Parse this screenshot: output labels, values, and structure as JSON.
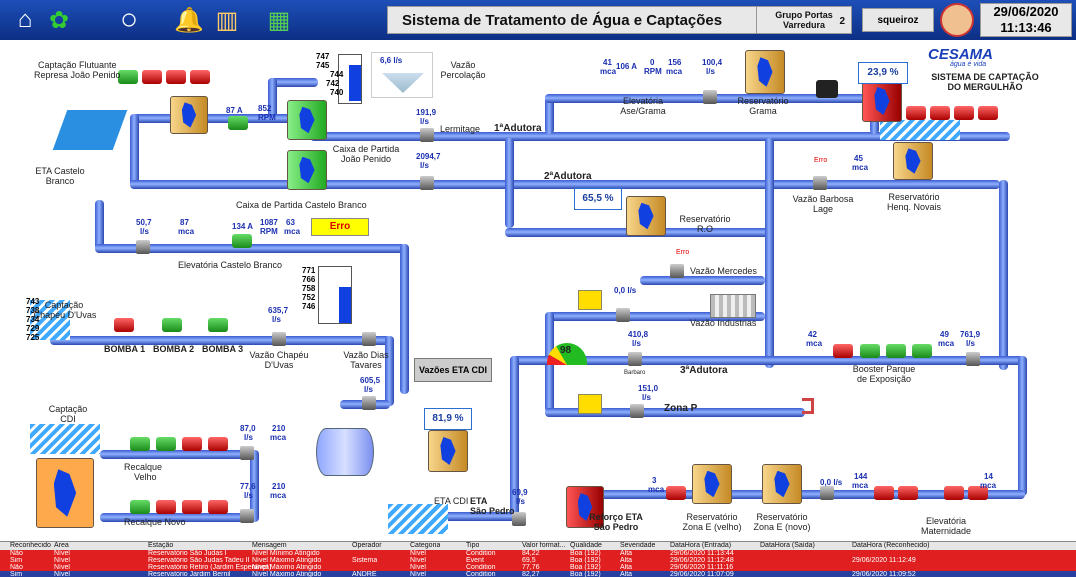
{
  "header": {
    "title": "Sistema de Tratamento de Água e Captações",
    "group_l1": "Grupo Portas",
    "group_l2": "Varredura",
    "group_num": "2",
    "user": "squeiroz",
    "date": "29/06/2020",
    "time": "11:13:46"
  },
  "toolbar": {
    "icons": [
      "home-icon",
      "puzzle-icon",
      "search-icon",
      "alarm-bell-icon",
      "panel-icon",
      "grid-icon"
    ]
  },
  "logo": {
    "brand": "CESAMA",
    "tagline": "água é vida",
    "system_l1": "SISTEMA DE CAPTAÇÃO",
    "system_l2": "DO MERGULHÃO"
  },
  "labels": {
    "captacao_flutuante": "Captação Flutuante",
    "represa": "Represa João Penido",
    "eta_cb_1": "ETA Castelo",
    "eta_cb_2": "Branco",
    "vazao_perc_1": "Vazão",
    "vazao_perc_2": "Percolação",
    "perc_val": "6,6 l/s",
    "caixa_jp_1": "Caixa de Partida",
    "caixa_jp_2": "João Penido",
    "lermitage": "Lermitage",
    "adutora1": "1ªAdutora",
    "adutora2": "2ªAdutora",
    "adutora3": "3ªAdutora",
    "caixa_cb": "Caixa de Partida Castelo Branco",
    "elev_cb": "Elevatória Castelo Branco",
    "elev_ase_1": "Elevatória",
    "elev_ase_2": "Ase/Grama",
    "res_grama_1": "Reservatório",
    "res_grama_2": "Grama",
    "vazao_bl_1": "Vazão Barbosa",
    "vazao_bl_2": "Lage",
    "res_hn_1": "Reservatório",
    "res_hn_2": "Henq. Novais",
    "res_ro_1": "Reservatório",
    "res_ro_2": "R.O",
    "vazao_merc": "Vazão Mercedes",
    "vazao_ind": "Vazão Industrias",
    "captacao_cu_1": "Captação",
    "captacao_cu_2": "Chapéu D'Uvas",
    "bomba1": "BOMBA 1",
    "bomba2": "BOMBA 2",
    "bomba3": "BOMBA 3",
    "vazao_cu_1": "Vazão Chapéu",
    "vazao_cu_2": "D'Uvas",
    "vazao_dt_1": "Vazão Dias",
    "vazao_dt_2": "Tavares",
    "vazoes_cdi": "Vazões ETA CDI",
    "booster_1": "Booster Parque",
    "booster_2": "de Exposição",
    "zona_p": "Zona P",
    "barbaro": "Barbaro",
    "captacao_cdi_1": "Captação",
    "captacao_cdi_2": "CDI",
    "recalque_velho_1": "Recalque",
    "recalque_velho_2": "Velho",
    "recalque_novo": "Recalque  Novo",
    "eta_cdi": "ETA CDI",
    "eta_sp_1": "ETA",
    "eta_sp_2": "São Pedro",
    "reforco_1": "Reforço ETA",
    "reforco_2": "São Pedro",
    "res_ze_velho_1": "Reservatório",
    "res_ze_velho_2": "Zona E (velho)",
    "res_ze_novo_1": "Reservatório",
    "res_ze_novo_2": "Zona E (novo)",
    "elev_mat_1": "Elevatória",
    "elev_mat_2": "Maternidade",
    "erro": "Erro"
  },
  "values": {
    "grama_pct": "23,9 %",
    "ro_pct": "65,5 %",
    "cdi_pct": "81,9 %",
    "gauge": "98",
    "v1_1": "87 A",
    "v1_2": "852",
    "v1_3": "RPM",
    "v2_1": "191,9",
    "v2_2": "l/s",
    "v3_1": "2094,7",
    "v3_2": "l/s",
    "ase_a_1": "41",
    "ase_a_2": "mca",
    "ase_b_1": "106 A",
    "ase_c_1": "0",
    "ase_c_2": "RPM",
    "ase_d_1": "156",
    "ase_d_2": "mca",
    "ase_e_1": "100,4",
    "ase_e_2": "l/s",
    "bl_1": "45",
    "bl_2": "mca",
    "cb_1": "50,7",
    "cb_2": "l/s",
    "cb_3": "87",
    "cb_4": "mca",
    "cb_5": "134 A",
    "cb_6": "1087",
    "cb_7": "RPM",
    "cb_8": "63",
    "cb_9": "mca",
    "merc_1": "0,0 l/s",
    "ind_1": "410,8",
    "ind_2": "l/s",
    "zp_1": "151,0",
    "zp_2": "l/s",
    "cu_1": "635,7",
    "cu_2": "l/s",
    "dt_1": "605,5",
    "dt_2": "l/s",
    "bo_1": "42",
    "bo_2": "mca",
    "bo_3": "49",
    "bo_4": "mca",
    "bo_5": "761,9",
    "bo_6": "l/s",
    "rv_1": "87,0",
    "rv_2": "l/s",
    "rv_3": "210",
    "rv_4": "mca",
    "rn_1": "77,6",
    "rn_2": "l/s",
    "rn_3": "210",
    "rn_4": "mca",
    "sp_1": "69,9",
    "sp_2": "l/s",
    "ze_1": "3",
    "ze_2": "mca",
    "mt_1": "0,0 l/s",
    "mt_2": "144",
    "mt_3": "mca",
    "mt_4": "14",
    "mt_5": "mca"
  },
  "level_scale_1": {
    "ticks": [
      "747",
      "745",
      "744",
      "742",
      "740"
    ]
  },
  "level_scale_2": {
    "ticks": [
      "771",
      "766",
      "758",
      "752",
      "746"
    ]
  },
  "level_scale_3": {
    "ticks": [
      "743",
      "738",
      "734",
      "729",
      "725"
    ]
  },
  "alarms": {
    "columns": [
      "Reconhecido",
      "Área",
      "Estação",
      "Mensagem",
      "Operador",
      "Categoria",
      "Tipo",
      "Valor format...",
      "Qualidade",
      "Severidade",
      "DataHora (Entrada)",
      "DataHora (Saída)",
      "DataHora (Reconhecido)"
    ],
    "rows": [
      {
        "c": [
          "Não",
          "Nível",
          "Reservatório São Judas I",
          "Nível Mínimo Atingido",
          "",
          "Nível",
          "Condition",
          "84,22",
          "Boa (192)",
          "Alta",
          "29/06/2020 11:13:44",
          "",
          ""
        ],
        "color": "#e02020"
      },
      {
        "c": [
          "Sim",
          "Nível",
          "Reservatório São Judas Tadeu II",
          "Nível Máximo Atingido",
          "Sistema",
          "Nível",
          "Event",
          "69,5",
          "Boa (192)",
          "Alta",
          "29/06/2020 11:12:48",
          "",
          "29/06/2020 11:12:49"
        ],
        "color": "#e02020"
      },
      {
        "c": [
          "Não",
          "Nível",
          "Reservatório Retiro (Jardim Esperança)",
          "Nível Máximo Atingido",
          "",
          "Nível",
          "Condition",
          "77,76",
          "Boa (192)",
          "Alta",
          "29/06/2020 11:11:16",
          "",
          ""
        ],
        "color": "#e02020"
      },
      {
        "c": [
          "Sim",
          "Nível",
          "Reservatório Jardim Bernil",
          "Nível Máximo Atingido",
          "ANDRÉ",
          "Nível",
          "Condition",
          "82,27",
          "Boa (192)",
          "Alta",
          "29/06/2020 11:07:09",
          "",
          "29/06/2020 11:09:52"
        ],
        "color": "#2840a0"
      }
    ]
  }
}
